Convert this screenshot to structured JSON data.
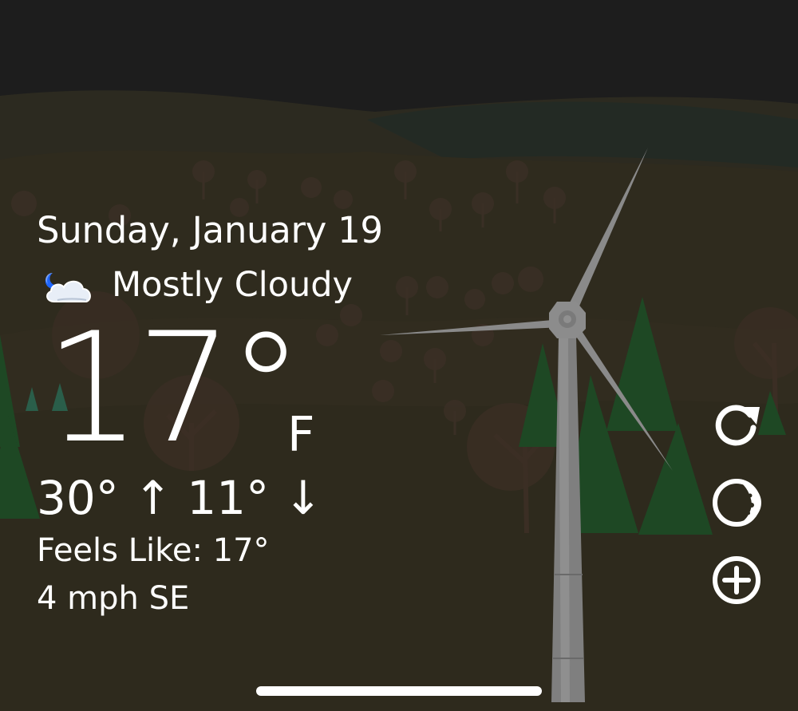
{
  "weather": {
    "date": "Sunday, January 19",
    "condition": "Mostly Cloudy",
    "condition_icon": "moon-cloud-icon",
    "temperature": "17°",
    "unit": "F",
    "high_low": "30° ↑  11° ↓",
    "feels_like": "Feels Like: 17°",
    "wind": "4 mph SE"
  },
  "controls": {
    "refresh_icon": "refresh-icon",
    "theme_icon": "moon-phase-icon",
    "add_icon": "add-circle-icon"
  },
  "colors": {
    "sky": "#1d1d1d",
    "hills": "#2f2b1f",
    "ground": "#2e2a1e",
    "trees_pine": "#1f4a24",
    "turbine": "#8e8e8e",
    "text": "#ffffff"
  }
}
